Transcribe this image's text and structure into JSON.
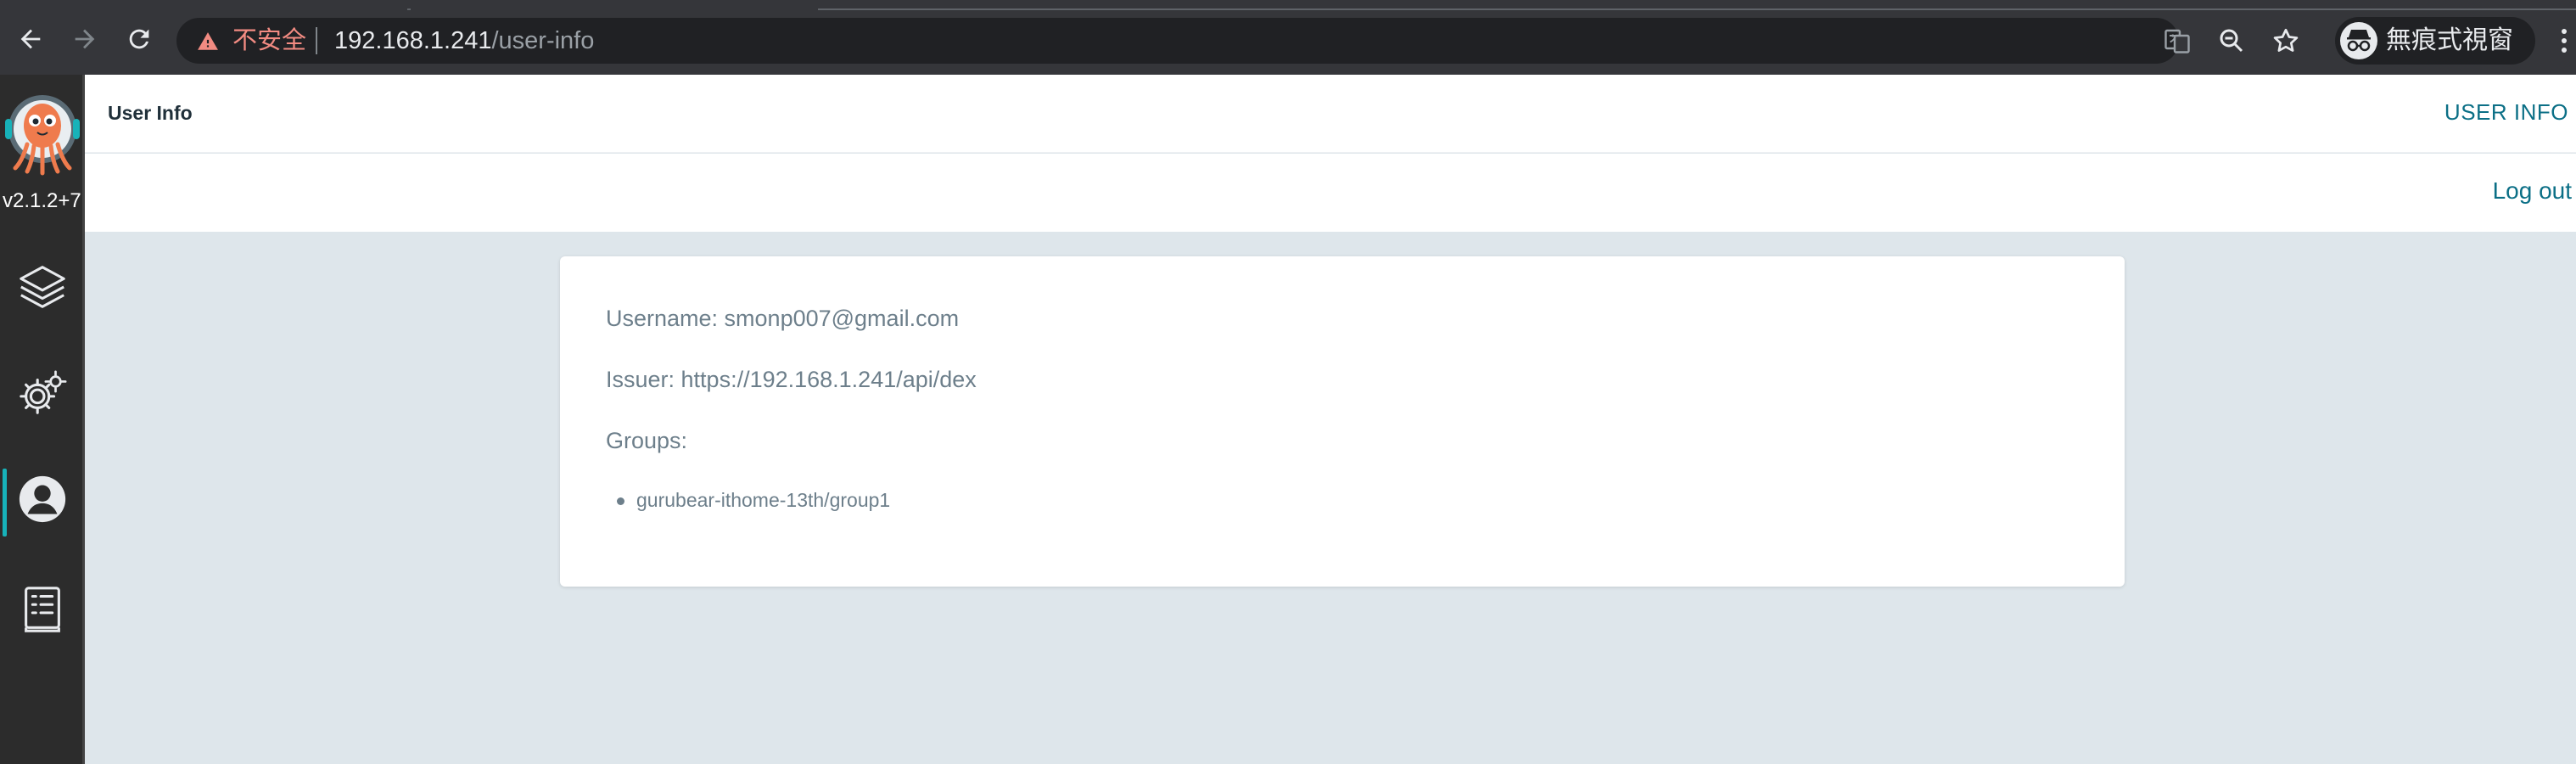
{
  "browser": {
    "security_label": "不安全",
    "url_host": "192.168.1.241",
    "url_path": "/user-info",
    "incognito_label": "無痕式視窗",
    "icons": [
      "back-icon",
      "forward-icon",
      "reload-icon",
      "warning-icon",
      "translate-icon",
      "zoom-out-icon",
      "star-icon",
      "incognito-icon",
      "more-vert-icon"
    ]
  },
  "sidebar": {
    "version": "v2.1.2+7",
    "items": [
      {
        "name": "applications",
        "icon": "layers-icon",
        "active": false
      },
      {
        "name": "settings",
        "icon": "gear-icon",
        "active": false
      },
      {
        "name": "user-info",
        "icon": "user-circle-icon",
        "active": true
      },
      {
        "name": "documentation",
        "icon": "book-icon",
        "active": false
      }
    ],
    "accent_color": "#17b2b9"
  },
  "header": {
    "title": "User Info",
    "nav_link": "USER INFO",
    "logout_label": "Log out"
  },
  "user": {
    "username_line": "Username: smonp007@gmail.com",
    "issuer_line": "Issuer: https://192.168.1.241/api/dex",
    "groups_label": "Groups:",
    "groups": [
      "gurubear-ithome-13th/group1"
    ]
  },
  "colors": {
    "link": "#0b6f86",
    "content_bg": "#dee6eb",
    "text_muted": "#6d7f8b"
  }
}
